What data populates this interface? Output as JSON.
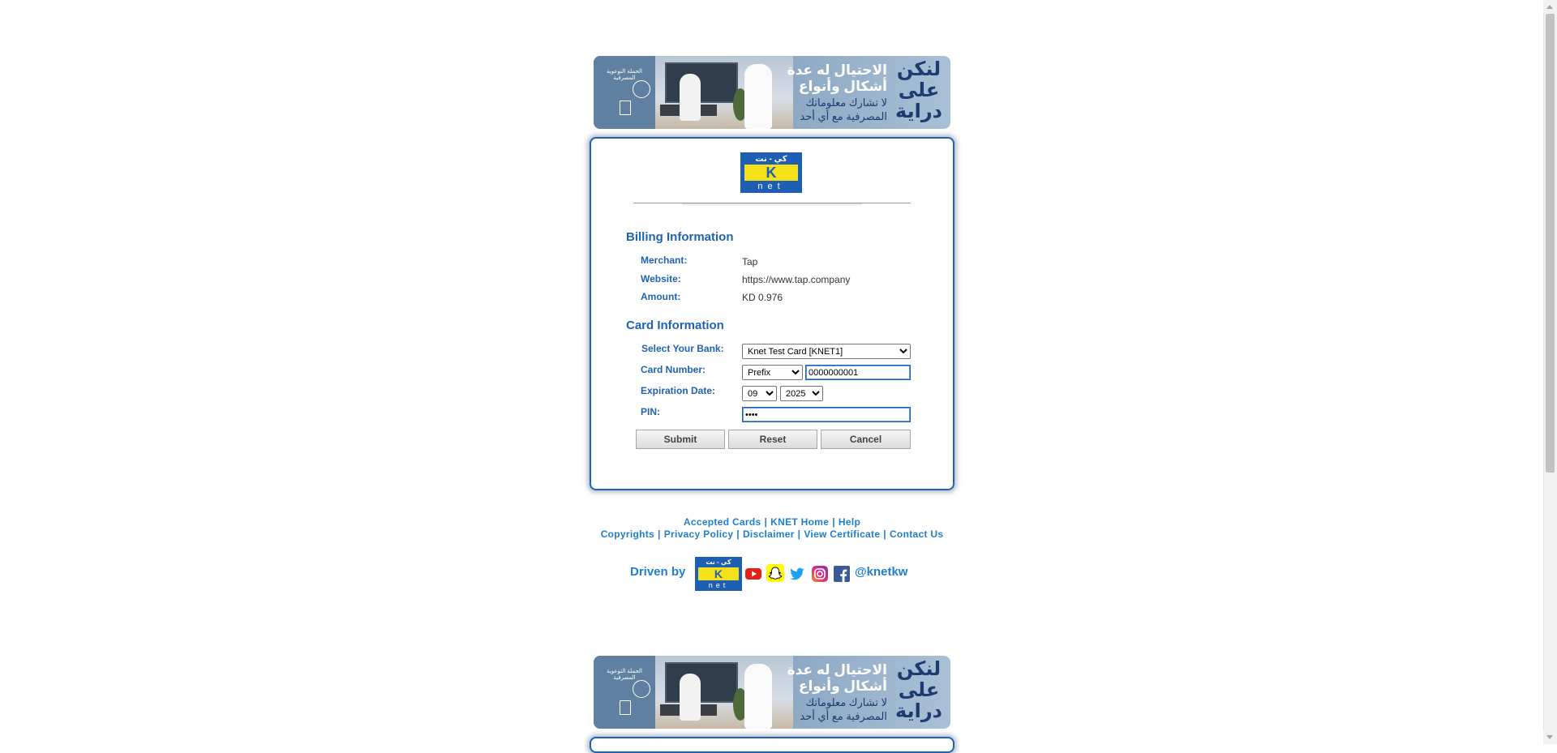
{
  "banner": {
    "line1": "الاحتيال له عدة",
    "line2": "أشكال وأنواع",
    "line3": "لا تشارك معلوماتك",
    "line4": "المصرفية مع أي أحد",
    "big": "لنكن على دراية",
    "seal_text": "الحملة التوعوية المصرفية"
  },
  "logo": {
    "arabic": "كي - نت",
    "letter": "K",
    "net": "net"
  },
  "billing": {
    "title": "Billing Information",
    "merchant_label": "Merchant:",
    "merchant_value": "Tap",
    "website_label": "Website:",
    "website_value": "https://www.tap.company",
    "amount_label": "Amount:",
    "amount_value": "KD 0.976"
  },
  "card": {
    "title": "Card Information",
    "bank_label": "Select Your Bank:",
    "bank_selected": "Knet Test Card [KNET1]",
    "card_number_label": "Card Number:",
    "prefix_selected": "Prefix",
    "card_number_value": "0000000001",
    "expiration_label": "Expiration Date:",
    "exp_month": "09",
    "exp_year": "2025",
    "pin_label": "PIN:",
    "pin_value": "••••"
  },
  "buttons": {
    "submit": "Submit",
    "reset": "Reset",
    "cancel": "Cancel"
  },
  "footer": {
    "row1": [
      "Accepted Cards",
      "KNET Home",
      "Help"
    ],
    "row2": [
      "Copyrights",
      "Privacy Policy",
      "Disclaimer",
      "View Certificate",
      "Contact Us"
    ],
    "driven_by": "Driven by",
    "handle": "@knetkw",
    "social_icons": [
      "youtube-icon",
      "snapchat-icon",
      "twitter-icon",
      "instagram-icon",
      "facebook-icon"
    ]
  },
  "colors": {
    "brand_blue": "#1f63b4",
    "link_blue": "#1f7fd0",
    "knet_yellow": "#f5e11a"
  }
}
